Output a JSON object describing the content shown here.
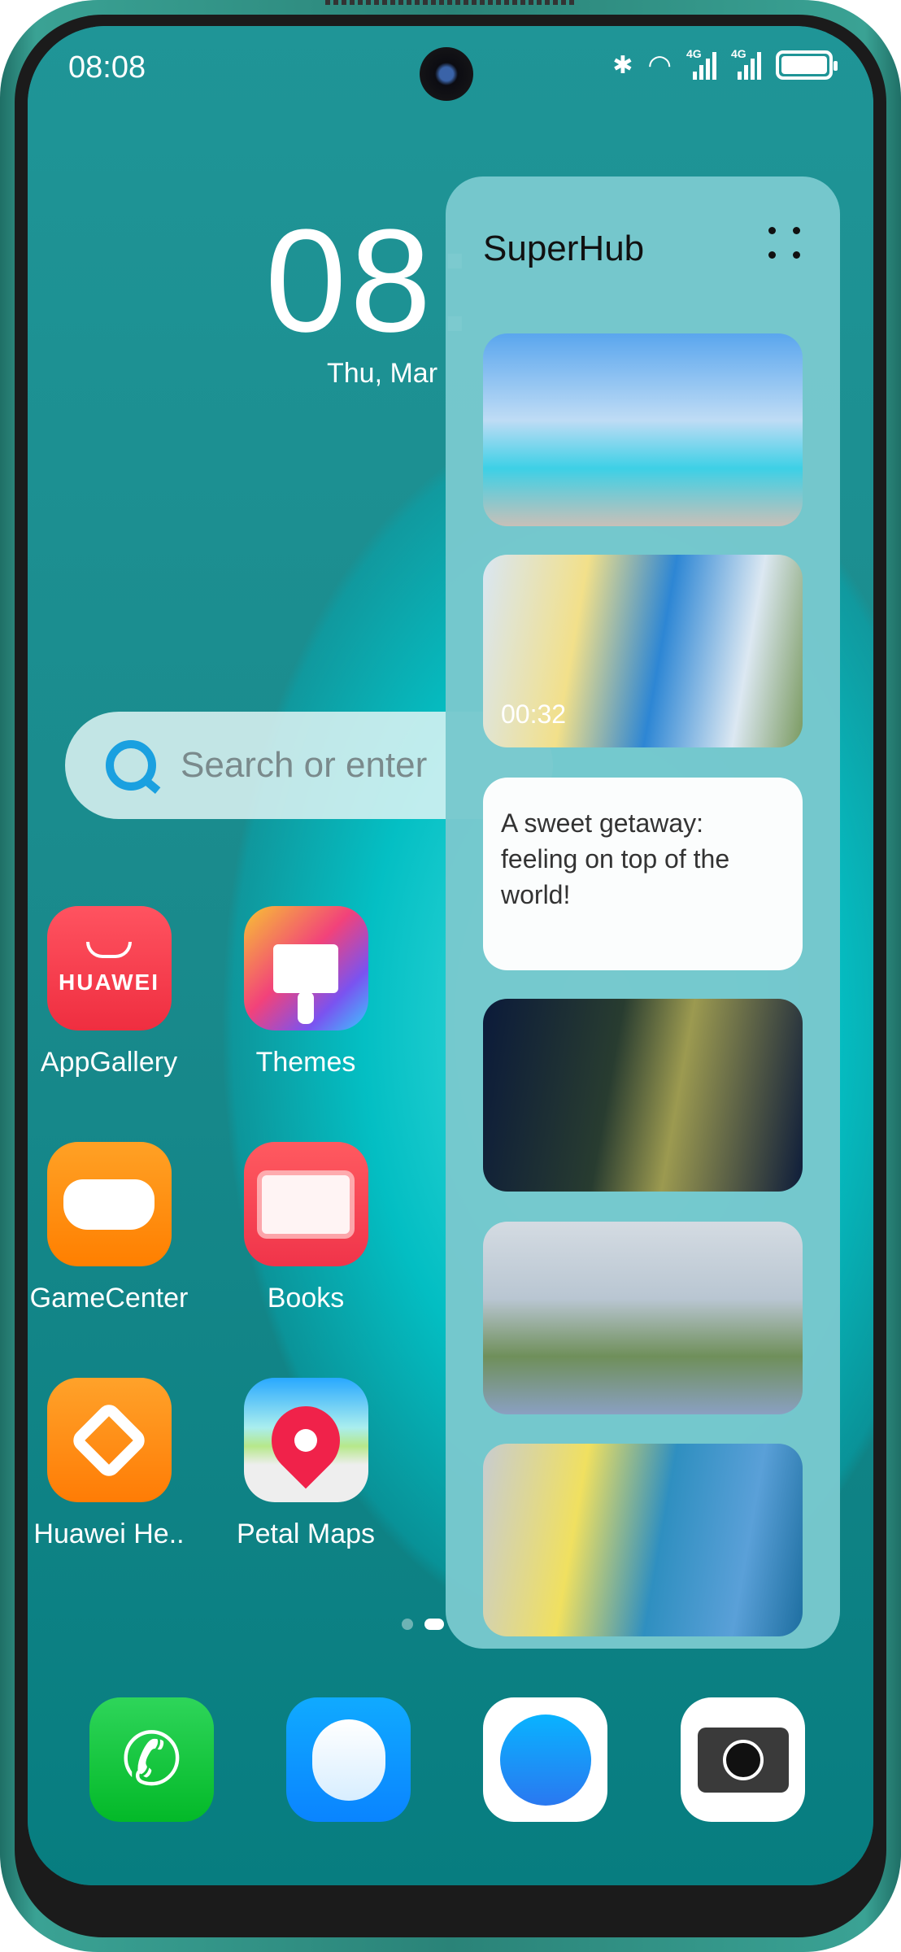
{
  "status_bar": {
    "time": "08:08",
    "icons": [
      "bluetooth-icon",
      "wifi-icon",
      "signal-4g-icon",
      "signal-4g-icon",
      "battery-icon"
    ],
    "network_label": "4G"
  },
  "clock": {
    "time": "08:",
    "date": "Thu, Mar"
  },
  "search": {
    "placeholder": "Search or enter"
  },
  "apps": [
    {
      "label": "AppGallery",
      "brand": "HUAWEI",
      "color": "#f23b4a"
    },
    {
      "label": "Themes",
      "color": "#e94b8b"
    },
    {
      "label": "GameCenter",
      "color": "#ff8a0d"
    },
    {
      "label": "Books",
      "color": "#f2424e"
    },
    {
      "label": "Huawei He..",
      "color": "#ff8a10"
    },
    {
      "label": "Petal Maps",
      "color": "#e8f0e8"
    }
  ],
  "dock": [
    {
      "name": "phone",
      "color": "#12c23a"
    },
    {
      "name": "messages",
      "color": "#0a95ff"
    },
    {
      "name": "browser",
      "color": "#ffffff"
    },
    {
      "name": "camera",
      "color": "#ffffff"
    }
  ],
  "superhub": {
    "title": "SuperHub",
    "cards": [
      {
        "type": "photo"
      },
      {
        "type": "video",
        "duration": "00:32"
      },
      {
        "type": "text",
        "text": "A sweet getaway: feeling on top of the world!"
      },
      {
        "type": "photo"
      },
      {
        "type": "photo"
      },
      {
        "type": "photo"
      }
    ]
  }
}
